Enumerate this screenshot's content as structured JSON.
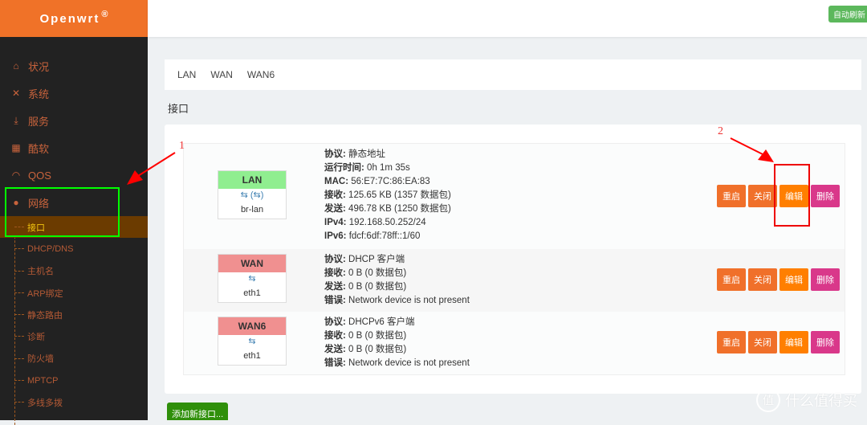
{
  "sidebar": {
    "brand": "Openwrt",
    "brand_mark": "®",
    "items": [
      {
        "label": "状况",
        "icon": "home-icon"
      },
      {
        "label": "系统",
        "icon": "tools-icon"
      },
      {
        "label": "服务",
        "icon": "download-icon"
      },
      {
        "label": "酷软",
        "icon": "calendar-icon"
      },
      {
        "label": "QOS",
        "icon": "gauge-icon"
      },
      {
        "label": "网络",
        "icon": "globe-icon"
      }
    ],
    "subitems": [
      {
        "label": "接口",
        "active": true
      },
      {
        "label": "DHCP/DNS"
      },
      {
        "label": "主机名"
      },
      {
        "label": "ARP绑定"
      },
      {
        "label": "静态路由"
      },
      {
        "label": "诊断"
      },
      {
        "label": "防火墙"
      },
      {
        "label": "MPTCP"
      },
      {
        "label": "多线多拨"
      }
    ]
  },
  "topbar": {
    "auto_refresh": "自动刷新"
  },
  "tabs": [
    "LAN",
    "WAN",
    "WAN6"
  ],
  "section_title": "接口",
  "interfaces": [
    {
      "name": "LAN",
      "color": "#90ee90",
      "icons": "⇆ (⇆)",
      "device": "br-lan",
      "info": [
        {
          "k": "协议:",
          "v": "静态地址"
        },
        {
          "k": "运行时间:",
          "v": "0h 1m 35s"
        },
        {
          "k": "MAC:",
          "v": "56:E7:7C:86:EA:83"
        },
        {
          "k": "接收:",
          "v": "125.65 KB (1357 数据包)"
        },
        {
          "k": "发送:",
          "v": "496.78 KB (1250 数据包)"
        },
        {
          "k": "IPv4:",
          "v": "192.168.50.252/24"
        },
        {
          "k": "IPv6:",
          "v": "fdcf:6df:78ff::1/60"
        }
      ]
    },
    {
      "name": "WAN",
      "color": "#f09090",
      "icons": "⇆",
      "device": "eth1",
      "info": [
        {
          "k": "协议:",
          "v": "DHCP 客户端"
        },
        {
          "k": "接收:",
          "v": "0 B (0 数据包)"
        },
        {
          "k": "发送:",
          "v": "0 B (0 数据包)"
        },
        {
          "k": "错误:",
          "v": "Network device is not present"
        }
      ]
    },
    {
      "name": "WAN6",
      "color": "#f09090",
      "icons": "⇆",
      "device": "eth1",
      "info": [
        {
          "k": "协议:",
          "v": "DHCPv6 客户端"
        },
        {
          "k": "接收:",
          "v": "0 B (0 数据包)"
        },
        {
          "k": "发送:",
          "v": "0 B (0 数据包)"
        },
        {
          "k": "错误:",
          "v": "Network device is not present"
        }
      ]
    }
  ],
  "actions": {
    "restart": "重启",
    "stop": "关闭",
    "edit": "编辑",
    "delete": "删除"
  },
  "add_interface": "添加新接口...",
  "annotations": {
    "one": "1",
    "two": "2"
  },
  "watermark": {
    "mark": "值",
    "text": "什么值得买"
  }
}
